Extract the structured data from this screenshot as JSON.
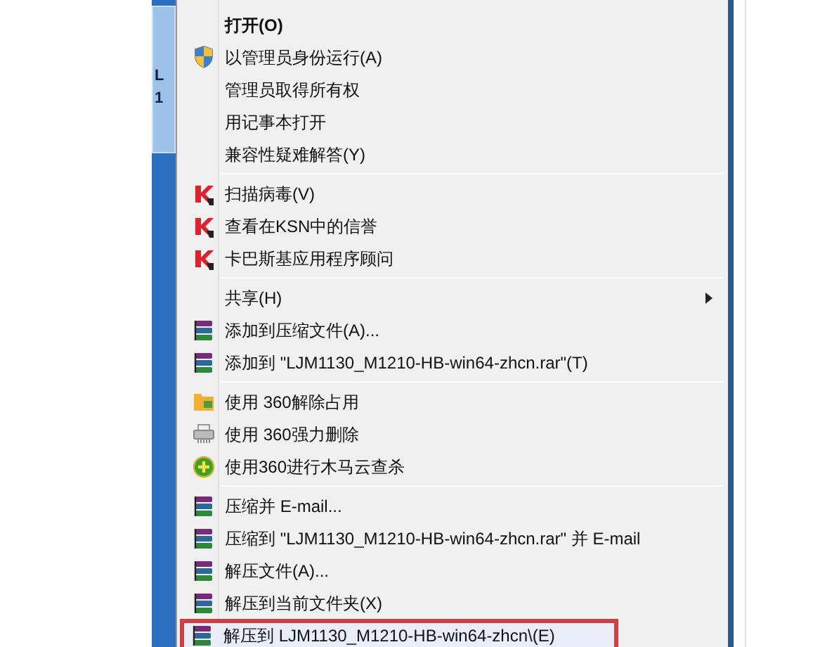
{
  "desktop_icon": {
    "label_lines": [
      "L",
      "1"
    ],
    "selected": true
  },
  "menu": {
    "groups": [
      [
        {
          "label": "打开(O)",
          "kind": "plain",
          "default": true,
          "submenu": false,
          "highlighted": false
        },
        {
          "label": "以管理员身份运行(A)",
          "kind": "shield",
          "default": false,
          "submenu": false,
          "highlighted": false
        },
        {
          "label": "管理员取得所有权",
          "kind": "plain",
          "default": false,
          "submenu": false,
          "highlighted": false
        },
        {
          "label": "用记事本打开",
          "kind": "plain",
          "default": false,
          "submenu": false,
          "highlighted": false
        },
        {
          "label": "兼容性疑难解答(Y)",
          "kind": "plain",
          "default": false,
          "submenu": false,
          "highlighted": false
        }
      ],
      [
        {
          "label": "扫描病毒(V)",
          "kind": "antivirus",
          "default": false,
          "submenu": false,
          "highlighted": false
        },
        {
          "label": "查看在KSN中的信誉",
          "kind": "antivirus",
          "default": false,
          "submenu": false,
          "highlighted": false
        },
        {
          "label": "卡巴斯基应用程序顾问",
          "kind": "antivirus",
          "default": false,
          "submenu": false,
          "highlighted": false
        }
      ],
      [
        {
          "label": "共享(H)",
          "kind": "plain",
          "default": false,
          "submenu": true,
          "highlighted": false
        },
        {
          "label": "添加到压缩文件(A)...",
          "kind": "archive",
          "default": false,
          "submenu": false,
          "highlighted": false
        },
        {
          "label": "添加到 \"LJM1130_M1210-HB-win64-zhcn.rar\"(T)",
          "kind": "archive",
          "default": false,
          "submenu": false,
          "highlighted": false
        }
      ],
      [
        {
          "label": "使用 360解除占用",
          "kind": "folder",
          "default": false,
          "submenu": false,
          "highlighted": false
        },
        {
          "label": "使用 360强力删除",
          "kind": "shredder",
          "default": false,
          "submenu": false,
          "highlighted": false
        },
        {
          "label": "使用360进行木马云查杀",
          "kind": "scan",
          "default": false,
          "submenu": false,
          "highlighted": false
        }
      ],
      [
        {
          "label": "压缩并 E-mail...",
          "kind": "archive",
          "default": false,
          "submenu": false,
          "highlighted": false
        },
        {
          "label": "压缩到 \"LJM1130_M1210-HB-win64-zhcn.rar\" 并 E-mail",
          "kind": "archive",
          "default": false,
          "submenu": false,
          "highlighted": false
        },
        {
          "label": "解压文件(A)...",
          "kind": "archive",
          "default": false,
          "submenu": false,
          "highlighted": false
        },
        {
          "label": "解压到当前文件夹(X)",
          "kind": "archive",
          "default": false,
          "submenu": false,
          "highlighted": false
        },
        {
          "label": "解压到 LJM1130_M1210-HB-win64-zhcn\\(E)",
          "kind": "archive",
          "default": false,
          "submenu": false,
          "highlighted": true
        }
      ]
    ]
  }
}
